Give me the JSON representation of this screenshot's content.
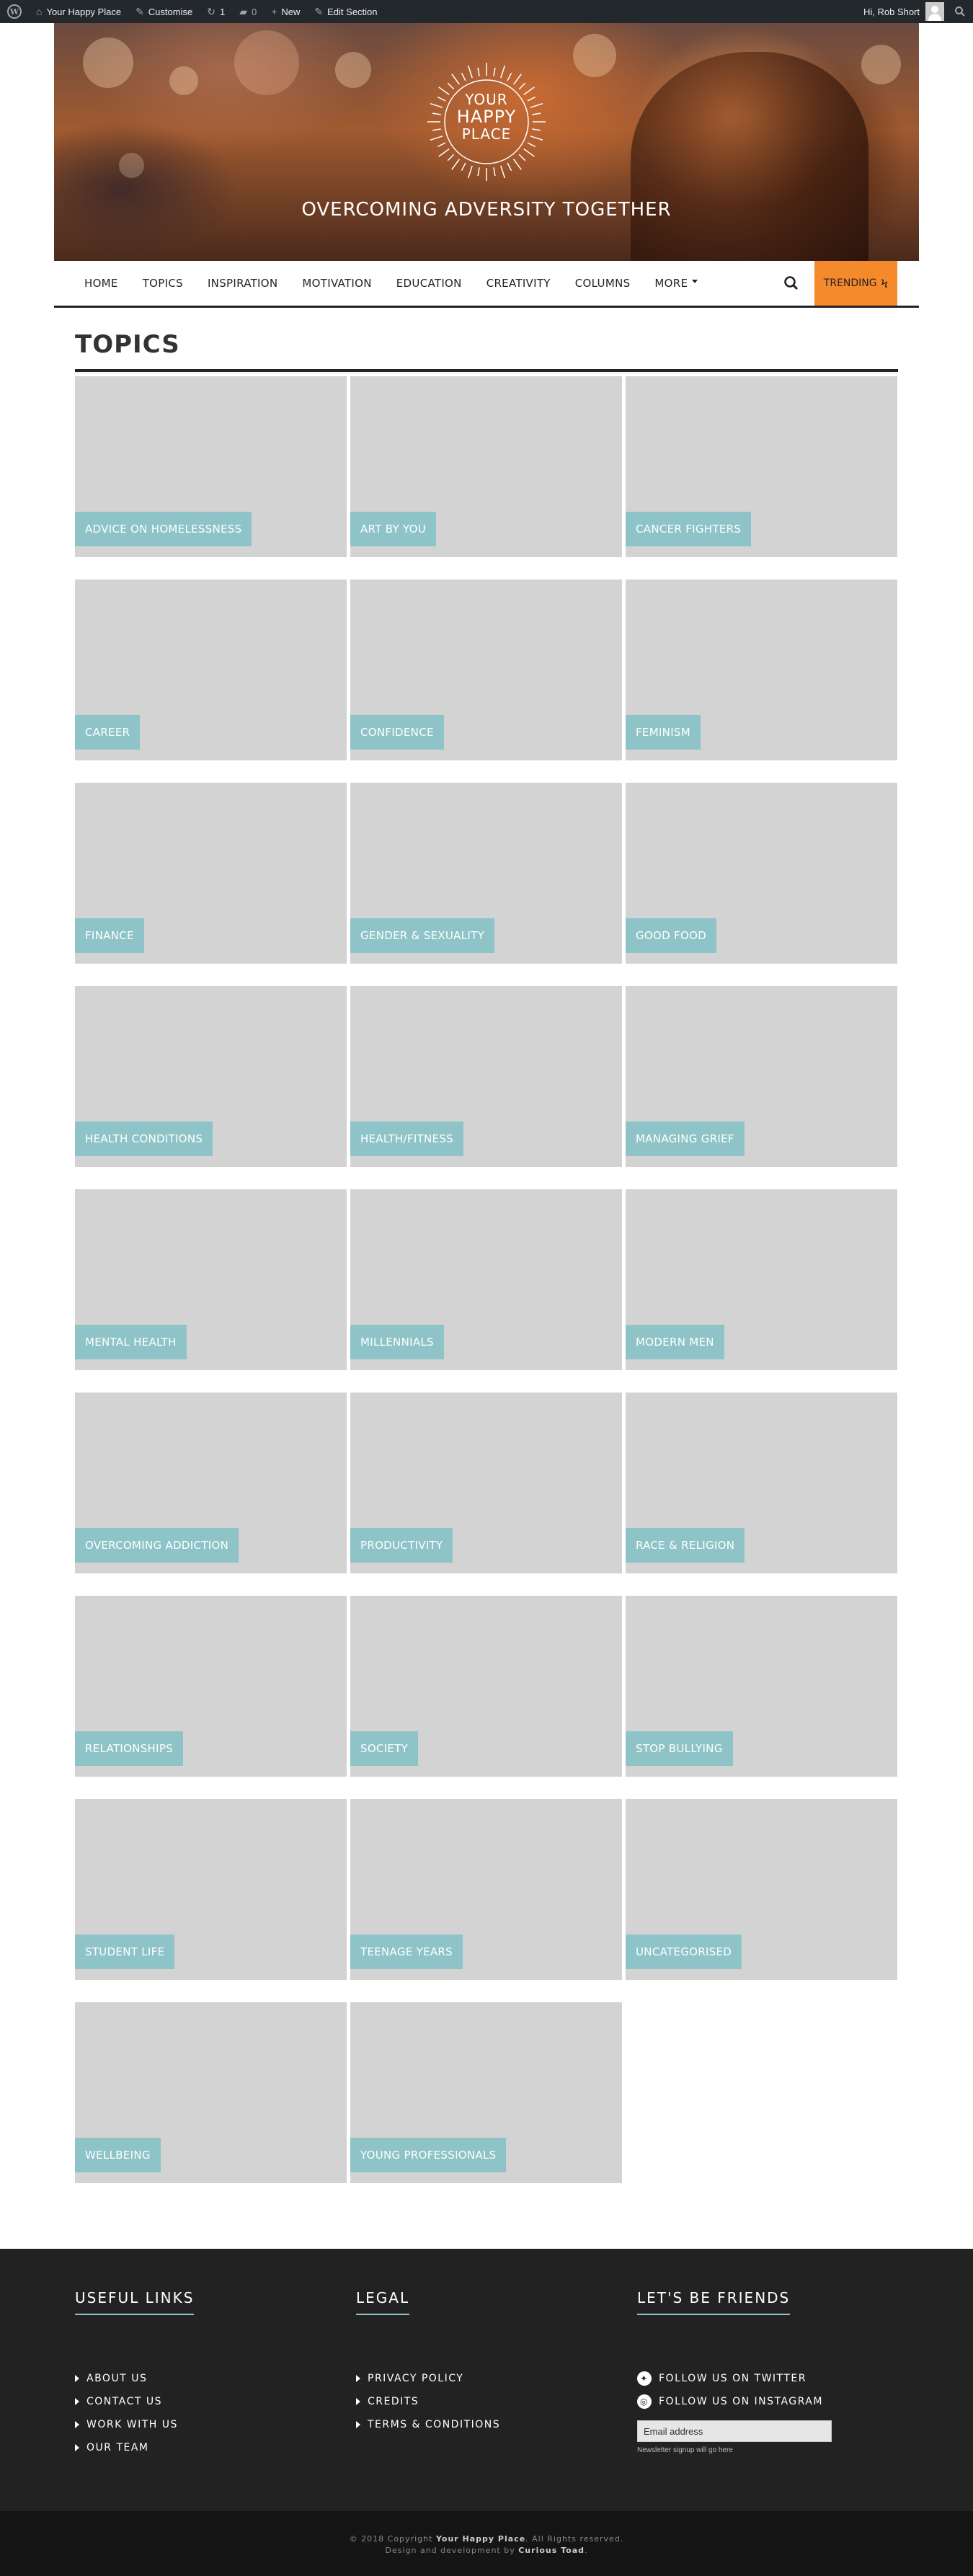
{
  "adminbar": {
    "site_name": "Your Happy Place",
    "customise": "Customise",
    "updates_count": "1",
    "comments_count": "0",
    "new_label": "New",
    "edit_label": "Edit Section",
    "greeting": "Hi, Rob Short"
  },
  "header": {
    "logo_line1": "YOUR",
    "logo_line2": "HAPPY",
    "logo_line3": "PLACE",
    "tagline": "OVERCOMING ADVERSITY TOGETHER"
  },
  "nav": {
    "items": [
      "HOME",
      "TOPICS",
      "INSPIRATION",
      "MOTIVATION",
      "EDUCATION",
      "CREATIVITY",
      "COLUMNS"
    ],
    "more_label": "MORE",
    "trending_label": "TRENDING"
  },
  "page": {
    "title": "TOPICS"
  },
  "topics": [
    "ADVICE ON HOMELESSNESS",
    "ART BY YOU",
    "CANCER FIGHTERS",
    "CAREER",
    "CONFIDENCE",
    "FEMINISM",
    "FINANCE",
    "GENDER & SEXUALITY",
    "GOOD FOOD",
    "HEALTH CONDITIONS",
    "HEALTH/FITNESS",
    "MANAGING GRIEF",
    "MENTAL HEALTH",
    "MILLENNIALS",
    "MODERN MEN",
    "OVERCOMING ADDICTION",
    "PRODUCTIVITY",
    "RACE & RELIGION",
    "RELATIONSHIPS",
    "SOCIETY",
    "STOP BULLYING",
    "STUDENT LIFE",
    "TEENAGE YEARS",
    "UNCATEGORISED",
    "WELLBEING",
    "YOUNG PROFESSIONALS"
  ],
  "footer": {
    "useful_links": {
      "heading": "USEFUL LINKS",
      "items": [
        "ABOUT US",
        "CONTACT US",
        "WORK WITH US",
        "OUR TEAM"
      ]
    },
    "legal": {
      "heading": "LEGAL",
      "items": [
        "PRIVACY POLICY",
        "CREDITS",
        "TERMS & CONDITIONS"
      ]
    },
    "friends": {
      "heading": "LET'S BE FRIENDS",
      "twitter": "FOLLOW US ON TWITTER",
      "instagram": "FOLLOW US ON INSTAGRAM",
      "email_placeholder": "Email address",
      "signup_note": "Newsletter signup will go here"
    },
    "copyright_prefix": "© 2018 Copyright",
    "copyright_site": "Your Happy Place",
    "copyright_suffix": ". All Rights reserved.",
    "credit_prefix": "Design and development by",
    "credit_name": "Curious Toad"
  },
  "colors": {
    "topic_label_bg": "#8ec4c8",
    "tile_bg": "#d3d3d3",
    "trending_bg": "#f58a2c",
    "footer_bg": "#222222"
  }
}
